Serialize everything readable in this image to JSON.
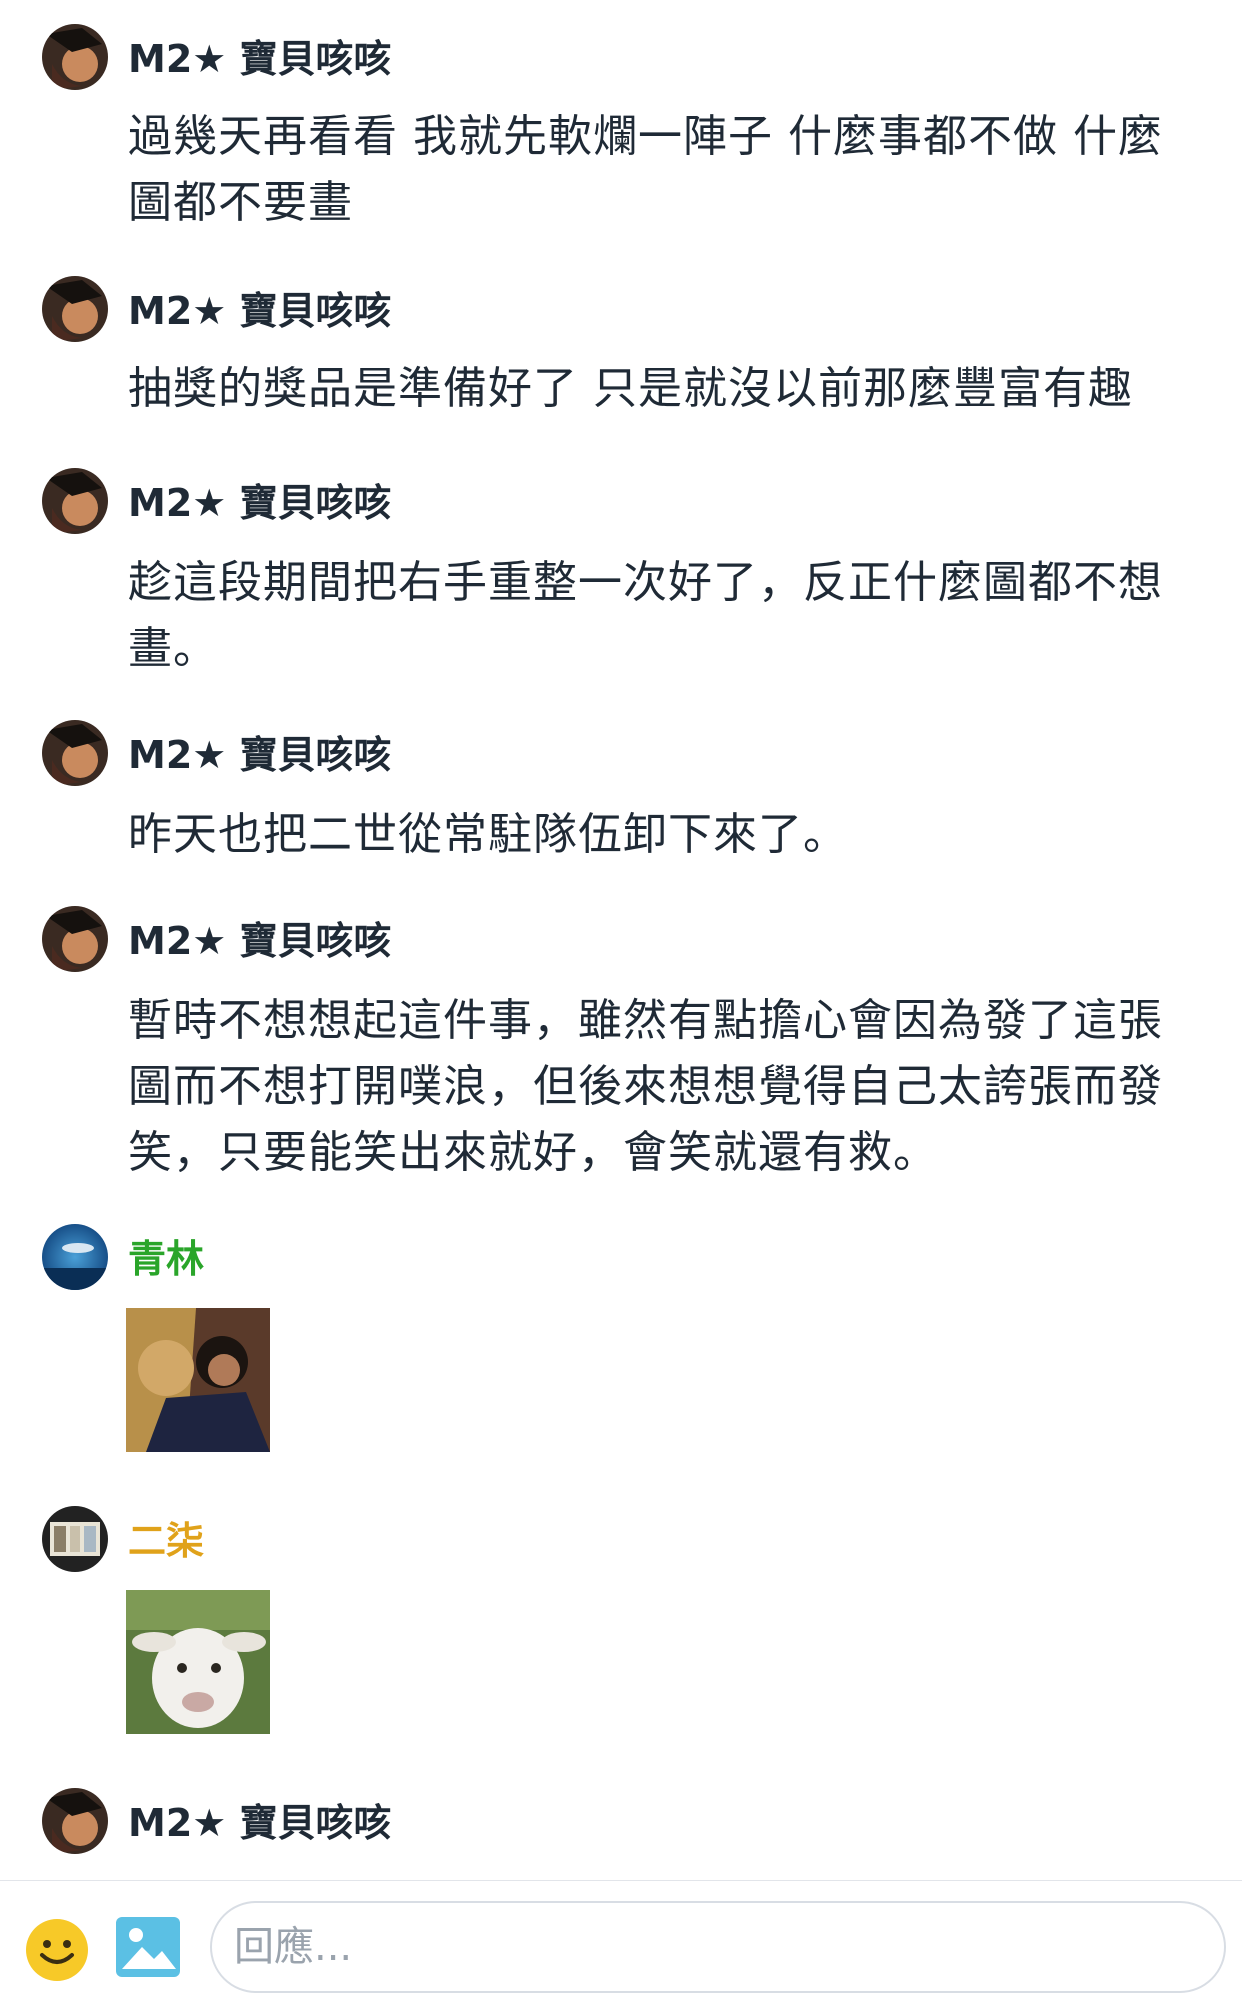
{
  "messages": [
    {
      "user": "M2★ 寶貝咳咳",
      "text": "過幾天再看看 我就先軟爛一陣子 什麼事都不做 什麼圖都不要畫"
    },
    {
      "user": "M2★ 寶貝咳咳",
      "text": "抽獎的獎品是準備好了 只是就沒以前那麼豐富有趣"
    },
    {
      "user": "M2★ 寶貝咳咳",
      "text": "趁這段期間把右手重整一次好了，反正什麼圖都不想畫。"
    },
    {
      "user": "M2★ 寶貝咳咳",
      "text": "昨天也把二世從常駐隊伍卸下來了。"
    },
    {
      "user": "M2★ 寶貝咳咳",
      "text": "暫時不想想起這件事，雖然有點擔心會因為發了這張圖而不想打開噗浪，但後來想想覺得自己太誇張而發笑，只要能笑出來就好，會笑就還有救。"
    },
    {
      "user": "青林",
      "user_color": "#2aa52a"
    },
    {
      "user": "二柒",
      "user_color": "#e0a21a"
    },
    {
      "user": "M2★ 寶貝咳咳"
    }
  ],
  "composer": {
    "placeholder": "回應...",
    "emoji_icon": "smile-emoji-icon",
    "image_icon": "image-upload-icon"
  }
}
